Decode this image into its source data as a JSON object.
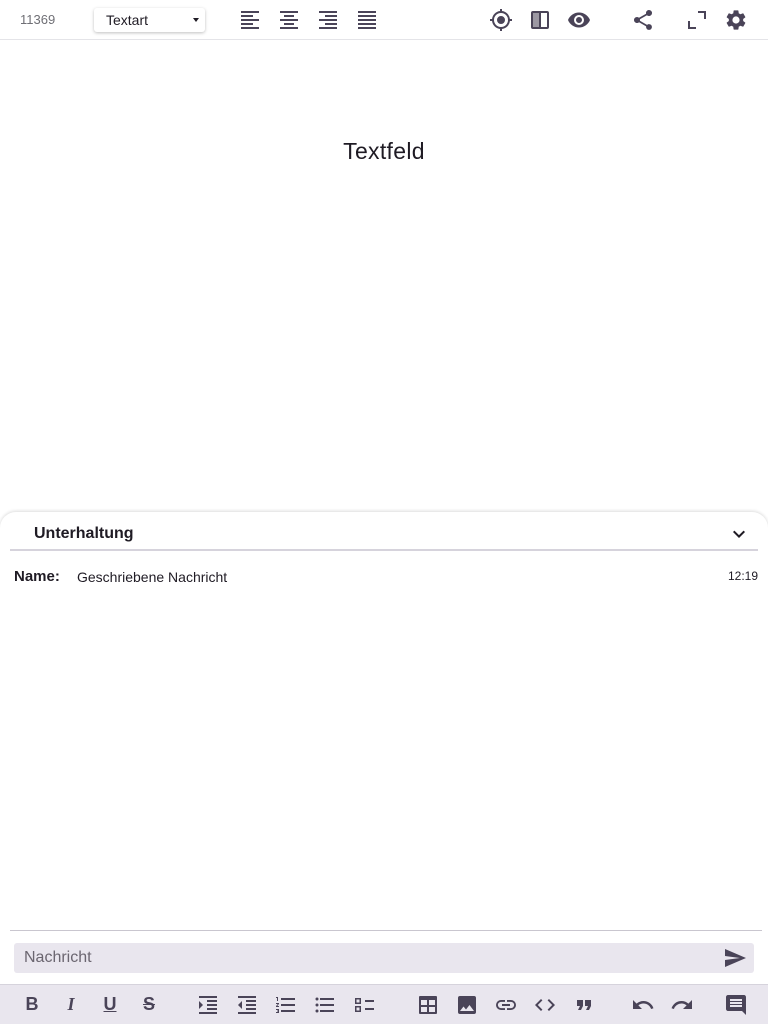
{
  "toolbar": {
    "doc_id": "11369",
    "text_style_value": "Textart",
    "icons": [
      "align-left-icon",
      "align-center-icon",
      "align-right-icon",
      "align-justify-icon",
      "crosshair-icon",
      "split-view-icon",
      "eye-icon",
      "share-icon",
      "expand-icon",
      "settings-icon"
    ]
  },
  "canvas": {
    "title": "Textfeld"
  },
  "conversation": {
    "title": "Unterhaltung",
    "messages": [
      {
        "name": "Name:",
        "text": "Geschriebene Nachricht",
        "time": "12:19"
      }
    ],
    "input_placeholder": "Nachricht"
  },
  "format_bar": {
    "bold": "B",
    "italic": "I",
    "underline": "U",
    "strike": "S",
    "icons": [
      "indent-icon",
      "outdent-icon",
      "ordered-list-icon",
      "bullet-list-icon",
      "checklist-icon",
      "table-icon",
      "image-icon",
      "link-icon",
      "code-icon",
      "quote-icon",
      "undo-icon",
      "redo-icon",
      "comment-icon"
    ]
  },
  "colors": {
    "icon": "#4a4458",
    "bar_background": "#e9e6ee",
    "text": "#1f1b24"
  }
}
